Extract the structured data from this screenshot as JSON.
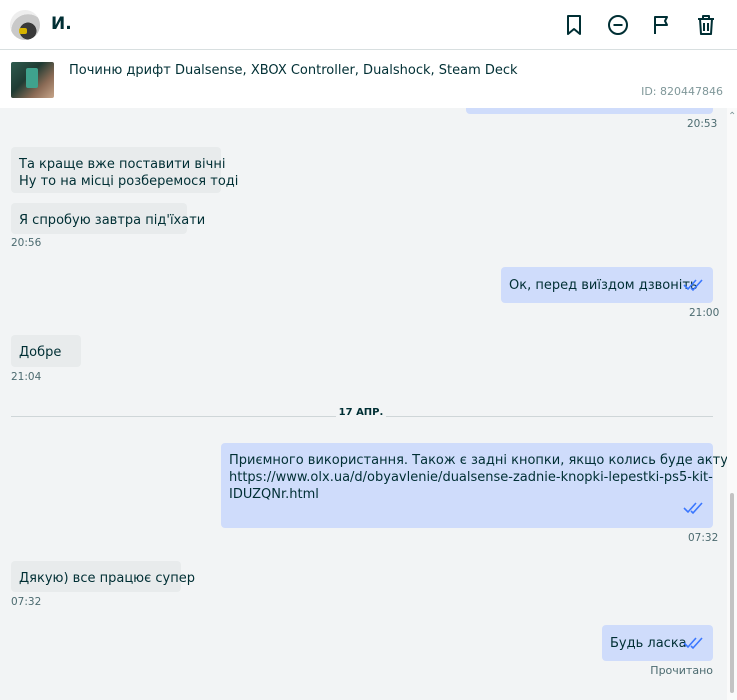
{
  "header": {
    "user_name": "И.",
    "icons": [
      "bookmark-icon",
      "block-icon",
      "flag-icon",
      "trash-icon"
    ]
  },
  "listing": {
    "title": "Починю дрифт Dualsense, XBOX Controller, Dualshock, Steam Deck",
    "id": "ID: 820447846"
  },
  "messages": {
    "m0_time": "20:53",
    "m1_line1": "Та краще вже поставити вічні",
    "m1_line2": "Ну то на місці розберемося тоді",
    "m2_text": "Я спробую завтра під'їхати",
    "m2_time": "20:56",
    "m3_text": "Ок, перед виїздом дзвоніть",
    "m3_time": "21:00",
    "m4_text": "Добре",
    "m4_time": "21:04",
    "date_separator": "17 АПР.",
    "m5_line1": "Приємного використання. Також є задні кнопки, якщо колись буде актуально:",
    "m5_line2": "https://www.olx.ua/d/obyavlenie/dualsense-zadnie-knopki-lepestki-ps5-kit-",
    "m5_line3": "IDUZQNr.html",
    "m5_time": "07:32",
    "m6_text": "Дякую) все працює супер",
    "m6_time": "07:32",
    "m7_text": "Будь ласка",
    "read_status": "Прочитано"
  },
  "colors": {
    "incoming_bubble": "#e8ebec",
    "outgoing_bubble": "#cfdcfb",
    "read_check": "#3a77ff",
    "chat_background": "#f2f4f5"
  }
}
